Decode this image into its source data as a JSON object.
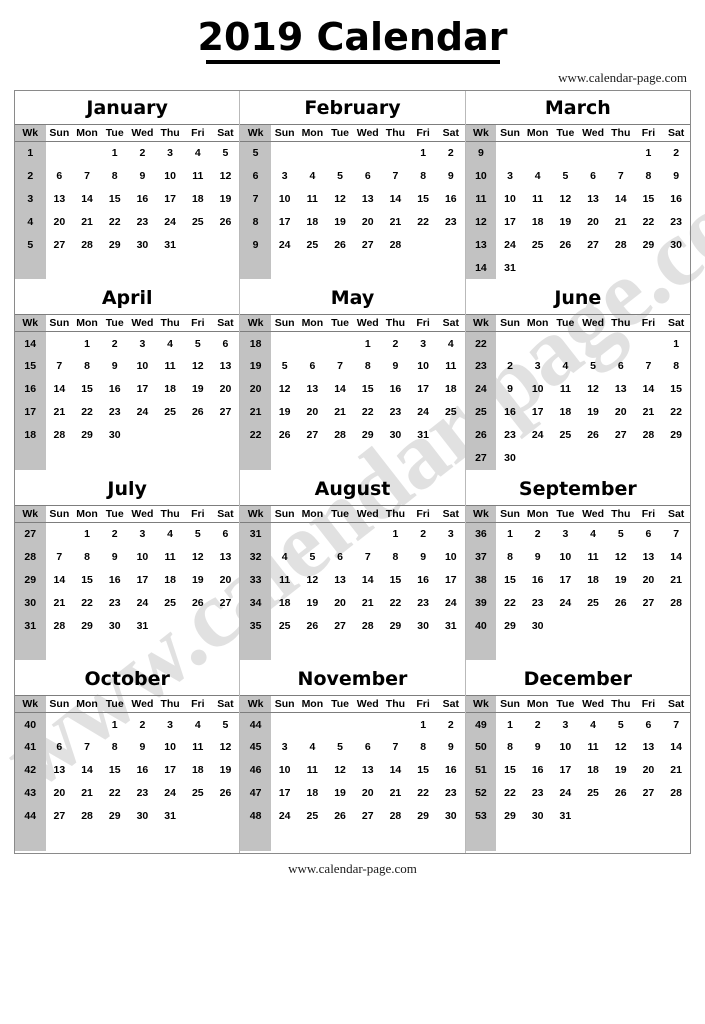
{
  "header": {
    "title": "2019 Calendar",
    "url": "www.calendar-page.com"
  },
  "footer": {
    "url": "www.calendar-page.com"
  },
  "watermark": {
    "text": "www.calendar-page.com"
  },
  "columns": {
    "week_header": "Wk",
    "days": [
      "Sun",
      "Mon",
      "Tue",
      "Wed",
      "Thu",
      "Fri",
      "Sat"
    ]
  },
  "colors": {
    "week_column_background": "#c2c2c2",
    "frame_border": "#8a8a8a",
    "header_rule": "#7d7d7d",
    "text": "#000000",
    "watermark": "#c9c9c9",
    "page_background": "#ffffff"
  },
  "year": "2019",
  "months": [
    {
      "name": "January",
      "weeks": [
        {
          "wk": "1",
          "days": [
            "",
            "",
            "1",
            "2",
            "3",
            "4",
            "5"
          ]
        },
        {
          "wk": "2",
          "days": [
            "6",
            "7",
            "8",
            "9",
            "10",
            "11",
            "12"
          ]
        },
        {
          "wk": "3",
          "days": [
            "13",
            "14",
            "15",
            "16",
            "17",
            "18",
            "19"
          ]
        },
        {
          "wk": "4",
          "days": [
            "20",
            "21",
            "22",
            "23",
            "24",
            "25",
            "26"
          ]
        },
        {
          "wk": "5",
          "days": [
            "27",
            "28",
            "29",
            "30",
            "31",
            "",
            ""
          ]
        }
      ]
    },
    {
      "name": "February",
      "weeks": [
        {
          "wk": "5",
          "days": [
            "",
            "",
            "",
            "",
            "",
            "1",
            "2"
          ]
        },
        {
          "wk": "6",
          "days": [
            "3",
            "4",
            "5",
            "6",
            "7",
            "8",
            "9"
          ]
        },
        {
          "wk": "7",
          "days": [
            "10",
            "11",
            "12",
            "13",
            "14",
            "15",
            "16"
          ]
        },
        {
          "wk": "8",
          "days": [
            "17",
            "18",
            "19",
            "20",
            "21",
            "22",
            "23"
          ]
        },
        {
          "wk": "9",
          "days": [
            "24",
            "25",
            "26",
            "27",
            "28",
            "",
            ""
          ]
        }
      ]
    },
    {
      "name": "March",
      "weeks": [
        {
          "wk": "9",
          "days": [
            "",
            "",
            "",
            "",
            "",
            "1",
            "2"
          ]
        },
        {
          "wk": "10",
          "days": [
            "3",
            "4",
            "5",
            "6",
            "7",
            "8",
            "9"
          ]
        },
        {
          "wk": "11",
          "days": [
            "10",
            "11",
            "12",
            "13",
            "14",
            "15",
            "16"
          ]
        },
        {
          "wk": "12",
          "days": [
            "17",
            "18",
            "19",
            "20",
            "21",
            "22",
            "23"
          ]
        },
        {
          "wk": "13",
          "days": [
            "24",
            "25",
            "26",
            "27",
            "28",
            "29",
            "30"
          ]
        },
        {
          "wk": "14",
          "days": [
            "31",
            "",
            "",
            "",
            "",
            "",
            ""
          ]
        }
      ]
    },
    {
      "name": "April",
      "weeks": [
        {
          "wk": "14",
          "days": [
            "",
            "1",
            "2",
            "3",
            "4",
            "5",
            "6"
          ]
        },
        {
          "wk": "15",
          "days": [
            "7",
            "8",
            "9",
            "10",
            "11",
            "12",
            "13"
          ]
        },
        {
          "wk": "16",
          "days": [
            "14",
            "15",
            "16",
            "17",
            "18",
            "19",
            "20"
          ]
        },
        {
          "wk": "17",
          "days": [
            "21",
            "22",
            "23",
            "24",
            "25",
            "26",
            "27"
          ]
        },
        {
          "wk": "18",
          "days": [
            "28",
            "29",
            "30",
            "",
            "",
            "",
            ""
          ]
        }
      ]
    },
    {
      "name": "May",
      "weeks": [
        {
          "wk": "18",
          "days": [
            "",
            "",
            "",
            "1",
            "2",
            "3",
            "4"
          ]
        },
        {
          "wk": "19",
          "days": [
            "5",
            "6",
            "7",
            "8",
            "9",
            "10",
            "11"
          ]
        },
        {
          "wk": "20",
          "days": [
            "12",
            "13",
            "14",
            "15",
            "16",
            "17",
            "18"
          ]
        },
        {
          "wk": "21",
          "days": [
            "19",
            "20",
            "21",
            "22",
            "23",
            "24",
            "25"
          ]
        },
        {
          "wk": "22",
          "days": [
            "26",
            "27",
            "28",
            "29",
            "30",
            "31",
            ""
          ]
        }
      ]
    },
    {
      "name": "June",
      "weeks": [
        {
          "wk": "22",
          "days": [
            "",
            "",
            "",
            "",
            "",
            "",
            "1"
          ]
        },
        {
          "wk": "23",
          "days": [
            "2",
            "3",
            "4",
            "5",
            "6",
            "7",
            "8"
          ]
        },
        {
          "wk": "24",
          "days": [
            "9",
            "10",
            "11",
            "12",
            "13",
            "14",
            "15"
          ]
        },
        {
          "wk": "25",
          "days": [
            "16",
            "17",
            "18",
            "19",
            "20",
            "21",
            "22"
          ]
        },
        {
          "wk": "26",
          "days": [
            "23",
            "24",
            "25",
            "26",
            "27",
            "28",
            "29"
          ]
        },
        {
          "wk": "27",
          "days": [
            "30",
            "",
            "",
            "",
            "",
            "",
            ""
          ]
        }
      ]
    },
    {
      "name": "July",
      "weeks": [
        {
          "wk": "27",
          "days": [
            "",
            "1",
            "2",
            "3",
            "4",
            "5",
            "6"
          ]
        },
        {
          "wk": "28",
          "days": [
            "7",
            "8",
            "9",
            "10",
            "11",
            "12",
            "13"
          ]
        },
        {
          "wk": "29",
          "days": [
            "14",
            "15",
            "16",
            "17",
            "18",
            "19",
            "20"
          ]
        },
        {
          "wk": "30",
          "days": [
            "21",
            "22",
            "23",
            "24",
            "25",
            "26",
            "27"
          ]
        },
        {
          "wk": "31",
          "days": [
            "28",
            "29",
            "30",
            "31",
            "",
            "",
            ""
          ]
        }
      ]
    },
    {
      "name": "August",
      "weeks": [
        {
          "wk": "31",
          "days": [
            "",
            "",
            "",
            "",
            "1",
            "2",
            "3"
          ]
        },
        {
          "wk": "32",
          "days": [
            "4",
            "5",
            "6",
            "7",
            "8",
            "9",
            "10"
          ]
        },
        {
          "wk": "33",
          "days": [
            "11",
            "12",
            "13",
            "14",
            "15",
            "16",
            "17"
          ]
        },
        {
          "wk": "34",
          "days": [
            "18",
            "19",
            "20",
            "21",
            "22",
            "23",
            "24"
          ]
        },
        {
          "wk": "35",
          "days": [
            "25",
            "26",
            "27",
            "28",
            "29",
            "30",
            "31"
          ]
        }
      ]
    },
    {
      "name": "September",
      "weeks": [
        {
          "wk": "36",
          "days": [
            "1",
            "2",
            "3",
            "4",
            "5",
            "6",
            "7"
          ]
        },
        {
          "wk": "37",
          "days": [
            "8",
            "9",
            "10",
            "11",
            "12",
            "13",
            "14"
          ]
        },
        {
          "wk": "38",
          "days": [
            "15",
            "16",
            "17",
            "18",
            "19",
            "20",
            "21"
          ]
        },
        {
          "wk": "39",
          "days": [
            "22",
            "23",
            "24",
            "25",
            "26",
            "27",
            "28"
          ]
        },
        {
          "wk": "40",
          "days": [
            "29",
            "30",
            "",
            "",
            "",
            "",
            ""
          ]
        }
      ]
    },
    {
      "name": "October",
      "weeks": [
        {
          "wk": "40",
          "days": [
            "",
            "",
            "1",
            "2",
            "3",
            "4",
            "5"
          ]
        },
        {
          "wk": "41",
          "days": [
            "6",
            "7",
            "8",
            "9",
            "10",
            "11",
            "12"
          ]
        },
        {
          "wk": "42",
          "days": [
            "13",
            "14",
            "15",
            "16",
            "17",
            "18",
            "19"
          ]
        },
        {
          "wk": "43",
          "days": [
            "20",
            "21",
            "22",
            "23",
            "24",
            "25",
            "26"
          ]
        },
        {
          "wk": "44",
          "days": [
            "27",
            "28",
            "29",
            "30",
            "31",
            "",
            ""
          ]
        }
      ]
    },
    {
      "name": "November",
      "weeks": [
        {
          "wk": "44",
          "days": [
            "",
            "",
            "",
            "",
            "",
            "1",
            "2"
          ]
        },
        {
          "wk": "45",
          "days": [
            "3",
            "4",
            "5",
            "6",
            "7",
            "8",
            "9"
          ]
        },
        {
          "wk": "46",
          "days": [
            "10",
            "11",
            "12",
            "13",
            "14",
            "15",
            "16"
          ]
        },
        {
          "wk": "47",
          "days": [
            "17",
            "18",
            "19",
            "20",
            "21",
            "22",
            "23"
          ]
        },
        {
          "wk": "48",
          "days": [
            "24",
            "25",
            "26",
            "27",
            "28",
            "29",
            "30"
          ]
        }
      ]
    },
    {
      "name": "December",
      "weeks": [
        {
          "wk": "49",
          "days": [
            "1",
            "2",
            "3",
            "4",
            "5",
            "6",
            "7"
          ]
        },
        {
          "wk": "50",
          "days": [
            "8",
            "9",
            "10",
            "11",
            "12",
            "13",
            "14"
          ]
        },
        {
          "wk": "51",
          "days": [
            "15",
            "16",
            "17",
            "18",
            "19",
            "20",
            "21"
          ]
        },
        {
          "wk": "52",
          "days": [
            "22",
            "23",
            "24",
            "25",
            "26",
            "27",
            "28"
          ]
        },
        {
          "wk": "53",
          "days": [
            "29",
            "30",
            "31",
            "",
            "",
            "",
            ""
          ]
        }
      ]
    }
  ],
  "quarters": [
    [
      0,
      1,
      2
    ],
    [
      3,
      4,
      5
    ],
    [
      6,
      7,
      8
    ],
    [
      9,
      10,
      11
    ]
  ]
}
